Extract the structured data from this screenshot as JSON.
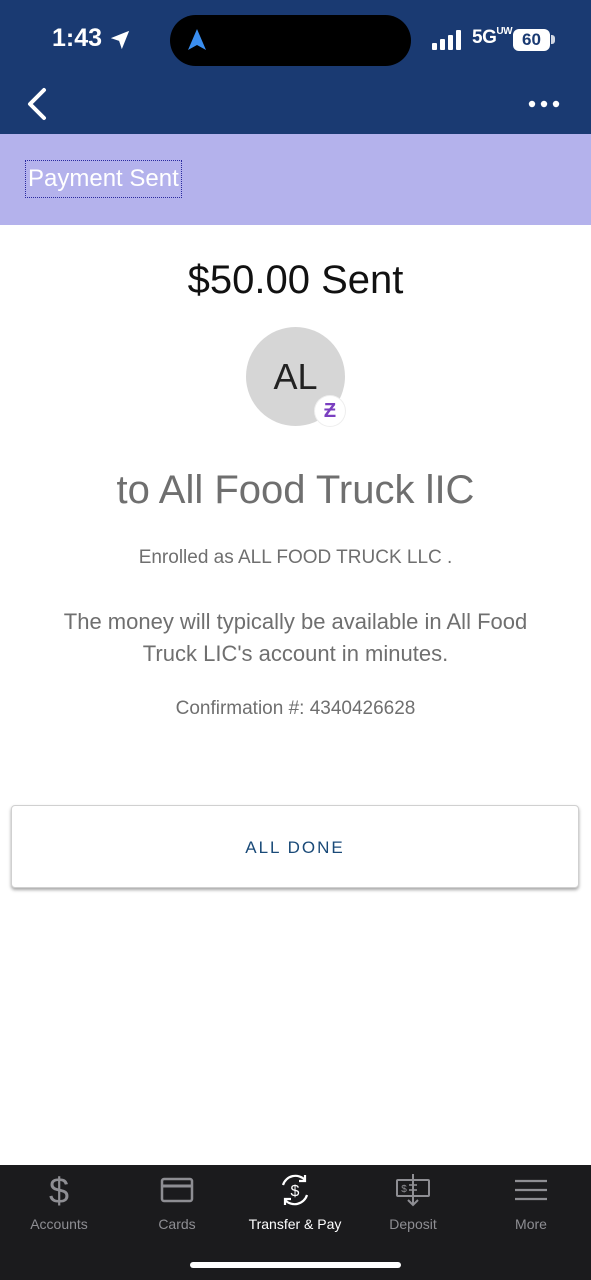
{
  "status_bar": {
    "time": "1:43",
    "network": "5G",
    "network_badge": "UW",
    "battery": "60",
    "icons": [
      "location-arrow-icon",
      "navigation-arrow-icon",
      "signal-bars-icon"
    ]
  },
  "nav": {
    "back_icon": "chevron-left-icon",
    "more_icon": "ellipsis-icon"
  },
  "header": {
    "title": "Payment Sent"
  },
  "payment": {
    "amount_text": "$50.00 Sent",
    "avatar_initials": "AL",
    "zelle_symbol": "Ƶ",
    "recipient_text": "to All Food Truck lIC",
    "enrolled_text": "Enrolled as ALL FOOD TRUCK LLC .",
    "availability_text": "The money will typically be available in All Food Truck LIC's account in minutes.",
    "confirmation_text": "Confirmation #: 4340426628"
  },
  "actions": {
    "done_label": "ALL DONE"
  },
  "tabbar": {
    "tabs": [
      {
        "label": "Accounts",
        "icon": "dollar-icon",
        "active": false
      },
      {
        "label": "Cards",
        "icon": "card-icon",
        "active": false
      },
      {
        "label": "Transfer & Pay",
        "icon": "transfer-pay-icon",
        "active": true
      },
      {
        "label": "Deposit",
        "icon": "deposit-check-icon",
        "active": false
      },
      {
        "label": "More",
        "icon": "menu-icon",
        "active": false
      }
    ]
  },
  "colors": {
    "header_bg": "#1a3a72",
    "subheader_bg": "#b4b2ec",
    "zelle_purple": "#7a3fc0",
    "tabbar_bg": "#1b1b1d"
  }
}
